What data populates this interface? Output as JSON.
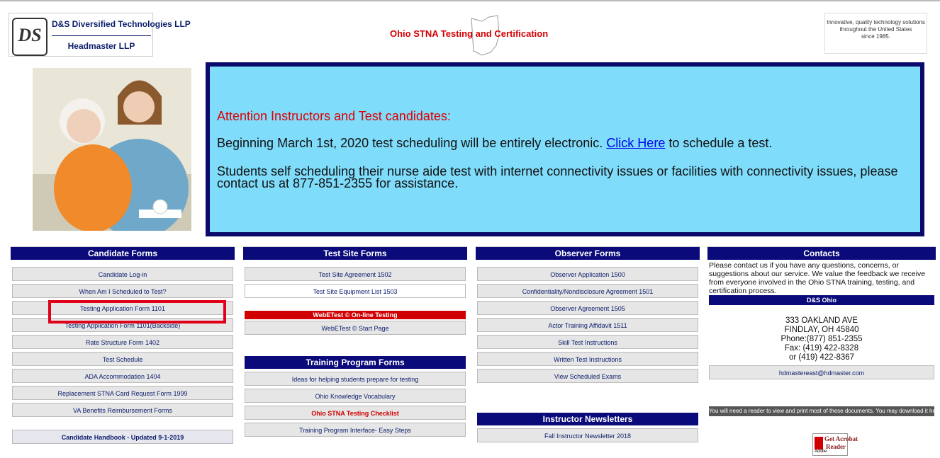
{
  "header": {
    "company_line1": "D&S Diversified Technologies LLP",
    "company_line2": "Headmaster LLP",
    "logo_text": "DS",
    "site_title": "Ohio STNA Testing and Certification",
    "tagline_line1": "Innovative, quality technology solutions",
    "tagline_line2": "throughout the United States",
    "tagline_line3": "since 1985."
  },
  "announcement": {
    "title": "Attention Instructors and Test candidates:",
    "p1_before": "Beginning March 1st, 2020 test scheduling will be entirely electronic. ",
    "p1_link": "Click Here",
    "p1_after": " to schedule a test.",
    "p2": "Students self scheduling their nurse aide test with internet connectivity issues or facilities with connectivity issues, please contact us at 877-851-2355 for assistance."
  },
  "candidate": {
    "heading": "Candidate Forms",
    "items": [
      "Candidate Log-in",
      "When Am I Scheduled to Test?",
      "Testing Application Form 1101",
      "Testing Application Form 1101(Backside)",
      "Rate Structure Form 1402",
      "Test Schedule",
      "ADA Accommodation 1404",
      "Replacement STNA Card Request Form 1999",
      "VA Benefits Reimbursement Forms"
    ],
    "handbook": "Candidate Handbook - Updated 9-1-2019"
  },
  "testsite": {
    "heading": "Test Site Forms",
    "items": [
      "Test Site Agreement 1502",
      "Test Site Equipment List 1503"
    ],
    "webetest_heading": "WebETest © On-line Testing",
    "webetest_item": "WebETest © Start Page",
    "training_heading": "Training Program Forms",
    "training_items": [
      "Ideas for helping students prepare for testing",
      "Ohio Knowledge Vocabulary",
      "Ohio STNA Testing Checklist",
      "Training Program Interface- Easy Steps"
    ]
  },
  "observer": {
    "heading": "Observer Forms",
    "items": [
      "Observer Application 1500",
      "Confidentiality/Nondisclosure Agreement 1501",
      "Observer Agreement 1505",
      "Actor Training Affidavit 1511",
      "Skill Test Instructions",
      "Written Test Instructions",
      "View Scheduled Exams"
    ],
    "newsletter_heading": "Instructor Newsletters",
    "newsletter_item": "Fall Instructor Newsletter 2018"
  },
  "contacts": {
    "heading": "Contacts",
    "text": "Please contact us if you have any questions, concerns, or suggestions about our service. We value the feedback we receive from everyone involved in the Ohio STNA training, testing, and certification process.",
    "office_heading": "D&S Ohio",
    "address1": "333 OAKLAND AVE",
    "address2": "FINDLAY, OH 45840",
    "phone": "Phone:(877) 851-2355",
    "fax": "Fax: (419) 422-8328",
    "alt_phone": "or (419) 422-8367",
    "email": "hdmastereast@hdmaster.com",
    "reader_notice": "You will need a reader to view and print most of these documents. You may download it here...",
    "acrobat_line1": "Get Acrobat",
    "acrobat_line2": "Reader",
    "acrobat_brand": "Adobe"
  },
  "colors": {
    "navy": "#0a0a7b",
    "announce_bg": "#7fdcfb",
    "alert_red": "#e00000"
  }
}
